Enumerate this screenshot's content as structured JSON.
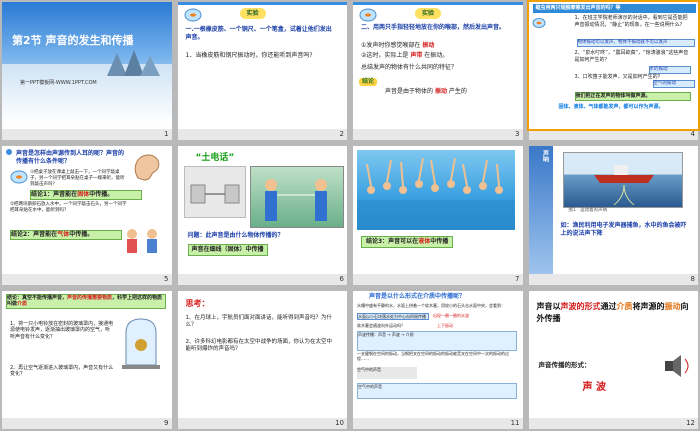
{
  "slides": [
    {
      "num": "1",
      "title": "第2节 声音的发生和传播",
      "footer": "第一PPT模板网-WWW.1PPT.COM"
    },
    {
      "num": "2",
      "badge": "实验",
      "p1": "一.一根橡皮筋、一个铜尺、一个笔盒，试着让他们发出声音。",
      "p2": "1．当橡皮筋和钢尺振动时，你还能听到声音吗?"
    },
    {
      "num": "3",
      "badge": "实验",
      "p1": "二、用两只手指轻轻地放在你的喉部，然后发出声音。",
      "p2": "①发声时你感觉喉部在",
      "a1": "振动",
      "p3": "②这时，实际上是",
      "a2": "声带",
      "p4": "在振动。",
      "p5": "总结发声的物体有什么共同的特征？",
      "conclusion_label": "结论",
      "p6": "声音是由于物体的",
      "a3": "振动",
      "p7": "产生的"
    },
    {
      "num": "4",
      "banner": "蝗虫用两只翅膀摩擦发出声音的吗？等",
      "q1": "1、在班主学院老师演示的对话中，看到它是否能把声音振动情况，“静止”的现象，在一些说明什么？",
      "box1": "物体振动可以发声，物体不振动就不可以发声",
      "q2": "2、“泉水叮咚”，“震耳欲聋”，“惊涛骇浪”这些声音是如何产生的？",
      "box2": "水的振动",
      "q3": "3、口吹笛子能发声，又是如何产生的？",
      "box3": "空气的振动",
      "q4": "我们把正在发声的物体叫做声源。",
      "box4": "固体、液体、气体都能发声，都可以作为声源。"
    },
    {
      "num": "5",
      "q": "声音是怎样由声源传到人耳的呢？声音的传播有什么条件呢？",
      "e1": "①把桌子放在课桌上敲击一下，一个同学敲桌子，另一个同学把耳朵贴在桌子一端来听，能听到敲击声吗？",
      "c1": "结论1：声音能在",
      "c1a": "固体",
      "c1b": "中传播。",
      "e2": "②把两块鹅卵石放入水中，一个同学敲击石头，另一个同学把耳朵贴在水中，能听到吗？",
      "c2": "结论2：声音能在",
      "c2a": "气体",
      "c2b": "中传播。"
    },
    {
      "num": "6",
      "title": "“土电话”",
      "q": "问题：此声音是由什么物体传播的？",
      "ans": "声音在细线（固体）中传播"
    },
    {
      "num": "7",
      "c": "结论3：声音可以在",
      "ca": "液体",
      "cb": "中传播"
    },
    {
      "num": "8",
      "tag": "声呐",
      "caption": "图1 · 运动着的声呐",
      "text": "如：渔民利用电子发声器捕鱼，水中的鱼会被吓上的说法声下降"
    },
    {
      "num": "9",
      "c": "结论：真空不能传播声音，",
      "ca": "声音的传播需要物质",
      "cb": "，科学上把这样的物质叫做",
      "cc": "介质",
      "p1": "1、将一只小电铃放在密封的玻璃罩内，接通电源使电铃发声，逐渐抽出玻璃罩内的空气，听听声音有什么变化？",
      "p2": "2、再让空气逐渐进入玻璃罩内，声音又有什么变化？"
    },
    {
      "num": "10",
      "h": "思考：",
      "p1": "1、在月球上，宇航员们面对面讲话，能听得到声音吗？为什么？",
      "p2": "2、许多科幻电影都有在太空中战争的场面，你认为在太空中能听到爆炸的声音吗？"
    },
    {
      "num": "11",
      "h": "声音是以什么形式在介质中传播呢？",
      "s1": "水槽中盛有平静的水，水面上拼着一个软木塞，用较小的石头击水面中央，会看到：",
      "s2": "水面以小石块落水处为中心向四周传播",
      "s3": "软木塞会随波向外运动吗？",
      "s4": "出现一圈一圈的水波",
      "s5": "上下振动",
      "s6": "声波传播：声音 → 声波 → 介质",
      "s7": "空气中的声音",
      "s8": "空气中的声音",
      "s9": "一支健钢在空间的振动，当钢把叉在空间的振动的振动被音叉在空间中一次的振动的过程……"
    },
    {
      "num": "12",
      "h1": "声音以",
      "h1a": "声波的形式",
      "h1b": "通过",
      "h1c": "介质",
      "h1d": "将声源的",
      "h1e": "振动",
      "h1f": "向外传播",
      "h2": "声音传播的形式：",
      "h3": "声  波"
    }
  ]
}
